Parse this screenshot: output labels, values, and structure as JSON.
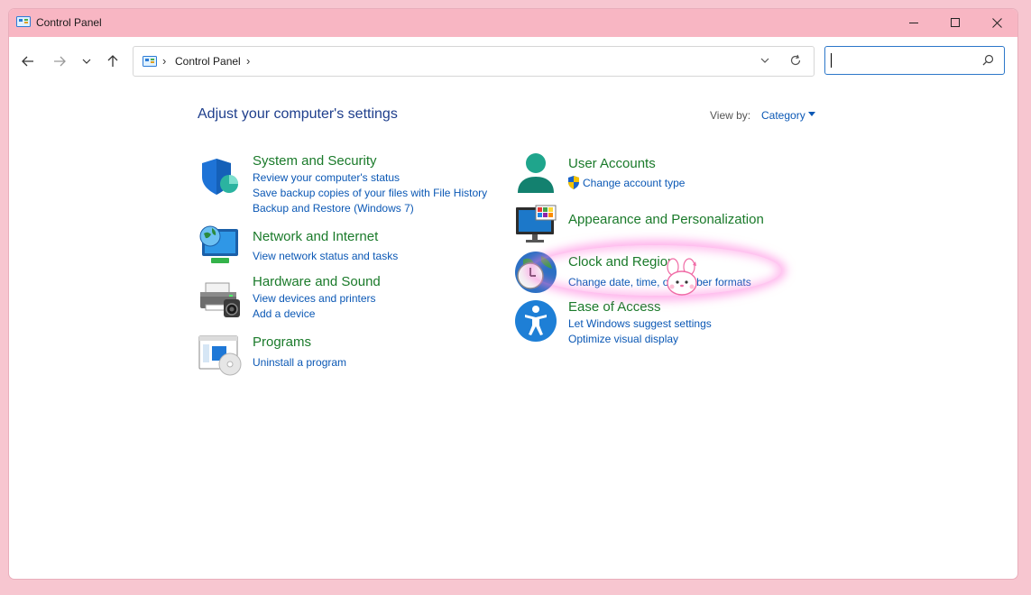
{
  "window": {
    "title": "Control Panel"
  },
  "address": {
    "path": "Control Panel",
    "separator": "›"
  },
  "search": {
    "placeholder": ""
  },
  "main": {
    "heading": "Adjust your computer's settings",
    "view_by_label": "View by:",
    "view_by_value": "Category"
  },
  "categories": [
    {
      "title": "System and Security",
      "icon": "shield-icon",
      "links": [
        "Review your computer's status",
        "Save backup copies of your files with File History",
        "Backup and Restore (Windows 7)"
      ]
    },
    {
      "title": "Network and Internet",
      "icon": "network-icon",
      "links": [
        "View network status and tasks"
      ]
    },
    {
      "title": "Hardware and Sound",
      "icon": "printer-icon",
      "links": [
        "View devices and printers",
        "Add a device"
      ]
    },
    {
      "title": "Programs",
      "icon": "programs-icon",
      "links": [
        "Uninstall a program"
      ]
    },
    {
      "title": "User Accounts",
      "icon": "user-icon",
      "links": [
        "Change account type"
      ]
    },
    {
      "title": "Appearance and Personalization",
      "icon": "monitor-icon",
      "links": []
    },
    {
      "title": "Clock and Region",
      "icon": "clock-globe-icon",
      "links": [
        "Change date, time, or number formats"
      ]
    },
    {
      "title": "Ease of Access",
      "icon": "accessibility-icon",
      "links": [
        "Let Windows suggest settings",
        "Optimize visual display"
      ]
    }
  ],
  "colors": {
    "accent": "#0b58b5",
    "category_title": "#1a7a2a",
    "heading": "#1e3e8c",
    "titlebar": "#f8b6c3"
  }
}
